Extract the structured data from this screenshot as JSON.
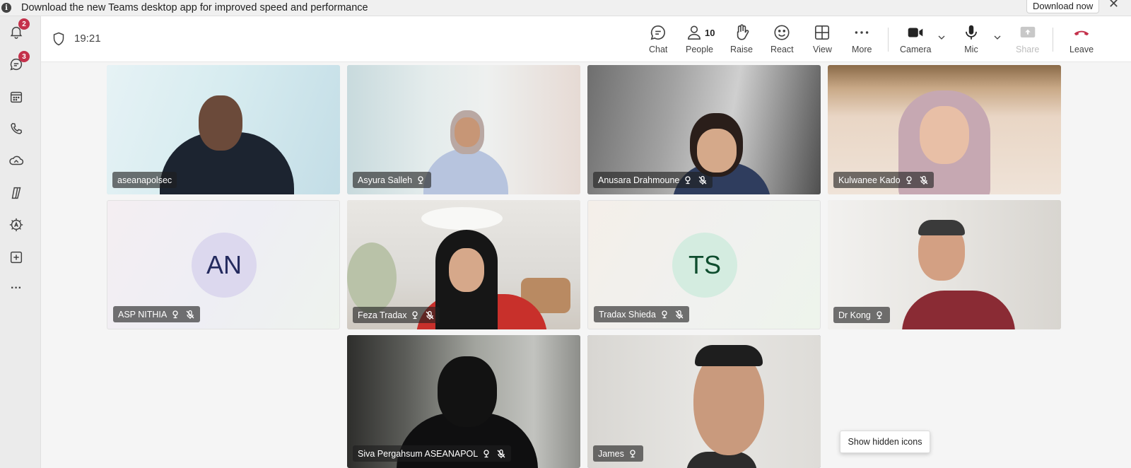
{
  "banner": {
    "message": "Download the new Teams desktop app for improved speed and performance",
    "download_label": "Download now",
    "close_glyph": "✕"
  },
  "rail": {
    "items": [
      {
        "icon": "bell-icon",
        "badge": "2"
      },
      {
        "icon": "chat-icon",
        "badge": "3"
      },
      {
        "icon": "calendar-icon"
      },
      {
        "icon": "phone-icon"
      },
      {
        "icon": "onedrive-icon"
      },
      {
        "icon": "copilot-icon"
      },
      {
        "icon": "apps-settings-icon"
      },
      {
        "icon": "add-app-icon"
      },
      {
        "icon": "more-dots-icon",
        "glyph": "···"
      }
    ]
  },
  "meeting": {
    "elapsed": "19:21",
    "toolbar": {
      "chat": "Chat",
      "people": "People",
      "people_count": "10",
      "raise": "Raise",
      "react": "React",
      "view": "View",
      "more": "More",
      "camera": "Camera",
      "mic": "Mic",
      "share": "Share",
      "leave": "Leave"
    }
  },
  "participants": [
    {
      "name": "aseanapolsec",
      "muted": false,
      "speaking": false
    },
    {
      "name": "Asyura Salleh",
      "muted": false,
      "speaking": false
    },
    {
      "name": "Anusara Drahmoune",
      "muted": true,
      "speaking": false
    },
    {
      "name": "Kulwanee Kado",
      "muted": true,
      "speaking": false
    },
    {
      "name": "ASP NITHIA",
      "initials": "AN",
      "muted": true
    },
    {
      "name": "Feza Tradax",
      "muted": true
    },
    {
      "name": "Tradax Shieda",
      "initials": "TS",
      "muted": true
    },
    {
      "name": "Dr Kong",
      "muted": false
    },
    {
      "name": "Siva Pergahsum ASEANAPOL",
      "muted": true
    },
    {
      "name": "James",
      "muted": false,
      "speaking": true
    }
  ],
  "tooltip": {
    "show_hidden_icons": "Show hidden icons"
  },
  "colors": {
    "accent": "#6264a7",
    "leave_red": "#c4314b",
    "badge_red": "#c4314b",
    "avatar_an_bg": "#dcd8ee",
    "avatar_an_fg": "#242a5e",
    "avatar_ts_bg": "#d4ece0",
    "avatar_ts_fg": "#0e4d2e"
  }
}
